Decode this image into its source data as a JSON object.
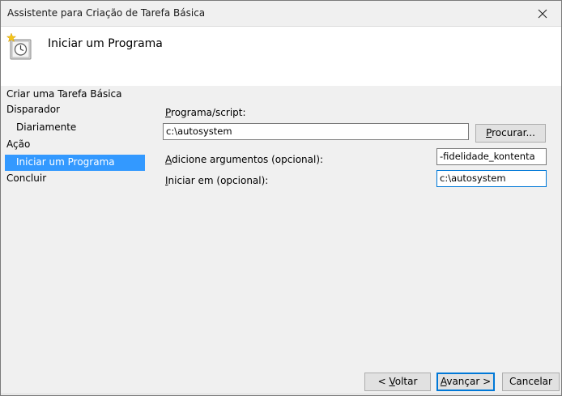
{
  "window": {
    "title": "Assistente para Criação de Tarefa Básica",
    "header_title": "Iniciar um Programa"
  },
  "sidebar": {
    "items": [
      {
        "label": "Criar uma Tarefa Básica"
      },
      {
        "label": "Disparador"
      },
      {
        "label": "Diariamente"
      },
      {
        "label": "Ação"
      },
      {
        "label": "Iniciar um Programa"
      },
      {
        "label": "Concluir"
      }
    ],
    "selected": "Iniciar um Programa"
  },
  "form": {
    "program": {
      "label_mnemonic": "P",
      "label_rest": "rograma/script:",
      "value": "c:\\autosystem"
    },
    "browse": {
      "label_pre": "",
      "label_mnemonic": "P",
      "label_rest": "rocurar..."
    },
    "args": {
      "label_pre": "",
      "label_mnemonic": "A",
      "label_rest": "dicione argumentos (opcional):",
      "value": "-fidelidade_kontenta"
    },
    "startin": {
      "label_mnemonic": "I",
      "label_rest": "niciar em (opcional):",
      "value": "c:\\autosystem"
    }
  },
  "buttons": {
    "back": {
      "pre": "< ",
      "mnemonic": "V",
      "rest": "oltar"
    },
    "next": {
      "pre": "",
      "mnemonic": "A",
      "rest": "vançar >"
    },
    "cancel": {
      "label": "Cancelar"
    }
  },
  "icons": {
    "header": "task-scheduler-clock-icon",
    "close": "close-icon"
  }
}
